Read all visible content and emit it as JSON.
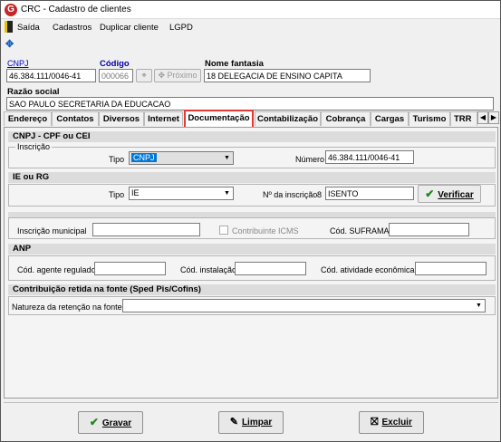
{
  "window": {
    "title": "CRC - Cadastro de clientes",
    "icon_letter": "G"
  },
  "menu": [
    "Saída",
    "Cadastros",
    "Duplicar cliente",
    "LGPD"
  ],
  "header": {
    "cnpj_label": "CNPJ",
    "cnpj_value": "46.384.111/0046-41",
    "codigo_label": "Código",
    "codigo_value": "000066",
    "proximo_label": "Próximo",
    "fantasia_label": "Nome fantasia",
    "fantasia_value": "18 DELEGACIA DE ENSINO  CAPITA",
    "razao_label": "Razão social",
    "razao_value": "SAO PAULO SECRETARIA DA EDUCACAO"
  },
  "tabs": [
    "Endereço",
    "Contatos",
    "Diversos",
    "Internet",
    "Documentação",
    "Contabilização",
    "Cobrança",
    "Cargas",
    "Turismo",
    "TRR"
  ],
  "cnpj_cpf": {
    "section_title": "CNPJ - CPF ou CEI",
    "group_label": "Inscrição",
    "tipo_label": "Tipo",
    "tipo_value": "CNPJ",
    "numero_label": "Número",
    "numero_value": "46.384.111/0046-41"
  },
  "ie_rg": {
    "section_title": "IE ou RG",
    "tipo_label": "Tipo",
    "tipo_value": "IE",
    "inscricao_label": "Nº da inscrição",
    "inscricao_mark": "8",
    "inscricao_value": "ISENTO",
    "verificar_label": "Verificar"
  },
  "misc": {
    "municipal_label": "Inscrição municipal",
    "icms_label": "Contribuinte ICMS",
    "suframa_label": "Cód. SUFRAMA"
  },
  "anp": {
    "section_title": "ANP",
    "agente_label": "Cód. agente regulado",
    "instalacao_label": "Cód. instalação",
    "atividade_label": "Cód. atividade econômica"
  },
  "retencao": {
    "section_title": "Contribuição retida na fonte  (Sped Pis/Cofins)",
    "natureza_label": "Natureza da retenção na fonte"
  },
  "footer": {
    "gravar": "Gravar",
    "limpar": "Limpar",
    "excluir": "Excluir"
  },
  "colors": {
    "accent_red": "#e53935",
    "selection": "#0078d7",
    "check_green": "#1b8a1b"
  }
}
